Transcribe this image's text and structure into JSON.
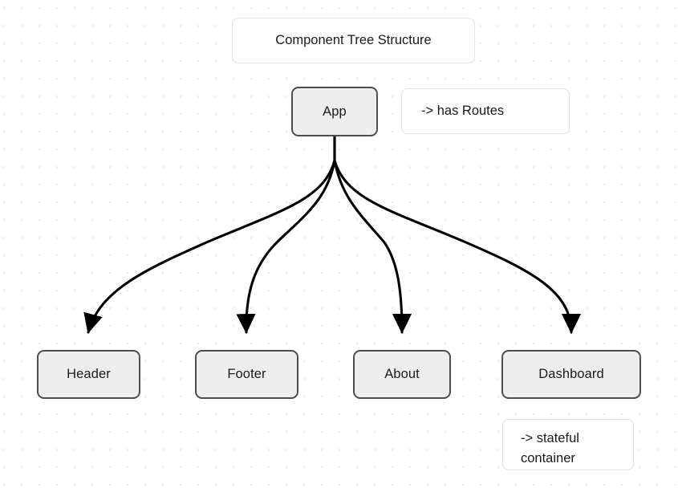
{
  "diagram": {
    "title_note": "Component Tree Structure",
    "background": "dot-grid",
    "node_fill": "#eeeeee",
    "node_border": "#4d4d4d",
    "edge_color": "#000000",
    "note_border": "#e3e3e5",
    "note_fill": "#ffffff",
    "root": {
      "id": "app",
      "label": "App"
    },
    "children": [
      {
        "id": "header",
        "label": "Header"
      },
      {
        "id": "footer",
        "label": "Footer"
      },
      {
        "id": "about",
        "label": "About"
      },
      {
        "id": "dashboard",
        "label": "Dashboard"
      }
    ],
    "notes": [
      {
        "id": "routes",
        "text": "-> has Routes",
        "attached_to": "app"
      },
      {
        "id": "stateful",
        "line1": "-> stateful",
        "line2": "container",
        "text": "-> stateful container",
        "attached_to": "dashboard"
      }
    ],
    "edges": [
      {
        "from": "App",
        "to": "Header",
        "arrow": "triangle"
      },
      {
        "from": "App",
        "to": "Footer",
        "arrow": "triangle"
      },
      {
        "from": "App",
        "to": "About",
        "arrow": "triangle"
      },
      {
        "from": "App",
        "to": "Dashboard",
        "arrow": "triangle"
      }
    ]
  }
}
